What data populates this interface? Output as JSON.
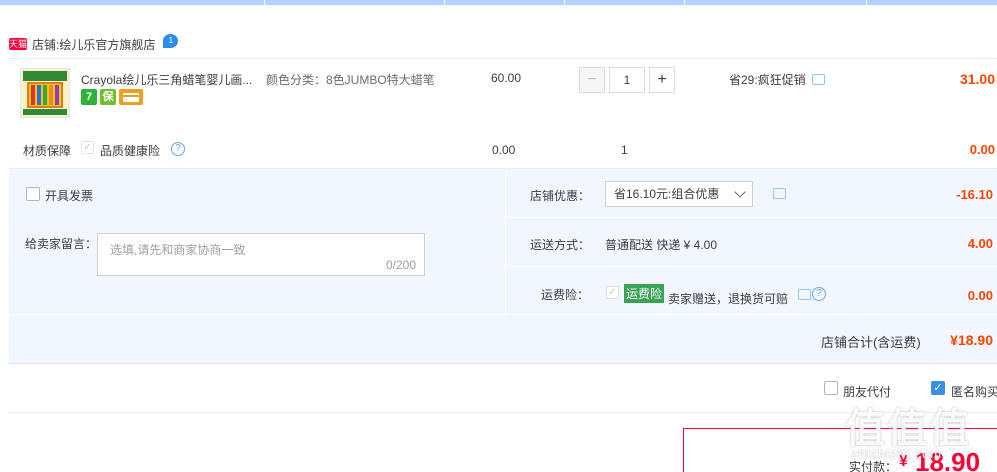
{
  "shop": {
    "badge": "天猫",
    "label": "店铺:",
    "name": "绘儿乐官方旗舰店",
    "chat_count": "1"
  },
  "item": {
    "title": "Crayola绘儿乐三角蜡笔婴儿画...",
    "sku": "颜色分类：8色JUMBO特大蜡笔",
    "price": "60.00",
    "quantity": "1",
    "promo": "省29:疯狂促销",
    "subtotal": "31.00",
    "service_icons": [
      "7",
      "保"
    ]
  },
  "insurance": {
    "label": "材质保障",
    "name": "品质健康险",
    "price": "0.00",
    "quantity": "1",
    "total": "0.00"
  },
  "invoice": {
    "label": "开具发票"
  },
  "memo": {
    "label": "给卖家留言：",
    "placeholder": "选填,请先和商家协商一致",
    "count": "0/200"
  },
  "discount": {
    "label": "店铺优惠：",
    "selected": "省16.10元:组合优惠",
    "value": "-16.10"
  },
  "shipping": {
    "label": "运送方式：",
    "value": "普通配送 快递 ¥ 4.00",
    "price": "4.00"
  },
  "return_insurance": {
    "label": "运费险：",
    "tag": "运费险",
    "text": "卖家赠送，退换货可赔",
    "value": "0.00"
  },
  "shop_total": {
    "label": "店铺合计(含运费)",
    "value": "¥18.90"
  },
  "options": {
    "friend_pay": "朋友代付",
    "anonymous": "匿名购买"
  },
  "payment": {
    "label": "实付款：",
    "currency": "¥",
    "value": "18.90"
  },
  "watermark": {
    "logo": "值值值",
    "text": "zhizhizhi.com"
  },
  "colors": {
    "accent_red": "#ff0036",
    "price_red": "#ff4400",
    "panel_bg": "#f2f7ff",
    "topbar": "#b2d1ff",
    "check_blue": "#3a8ee6"
  }
}
